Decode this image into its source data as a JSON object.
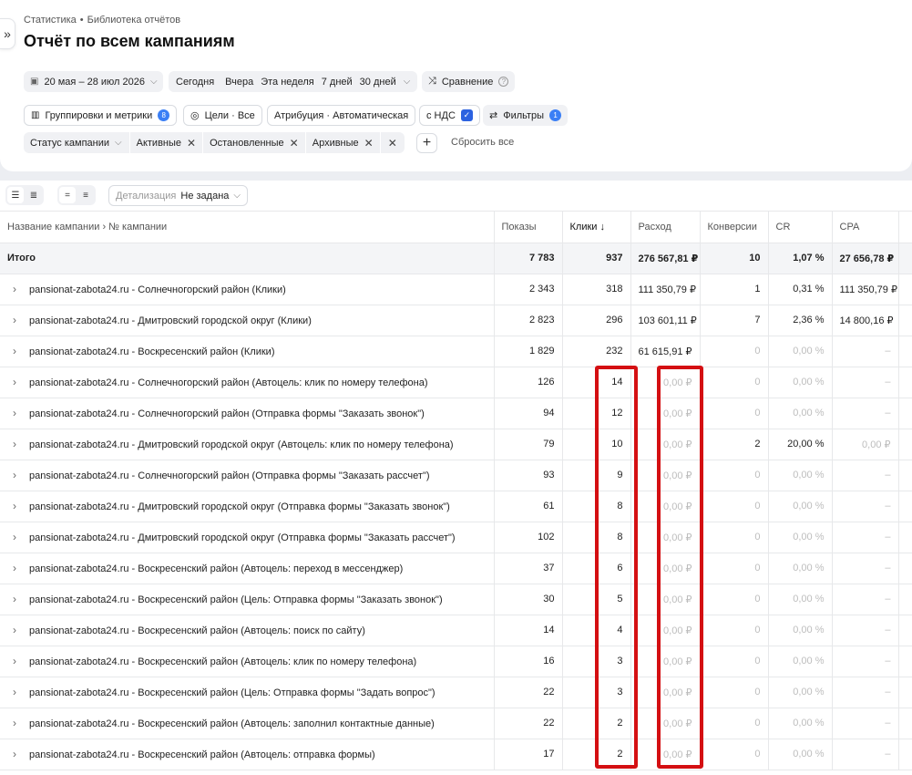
{
  "breadcrumb": [
    "Статистика",
    "•",
    "Библиотека отчётов"
  ],
  "page_title": "Отчёт по всем кампаниям",
  "toolbar": {
    "date_range": "20 мая – 28 июл 2026",
    "presets": [
      "Сегодня",
      "Вчера",
      "Эта неделя",
      "7 дней",
      "30 дней"
    ],
    "compare": "Сравнение",
    "groupings": "Группировки и метрики",
    "groupings_count": "8",
    "goals": "Цели · Все",
    "attribution": "Атрибуция · Автоматическая",
    "vat": "с НДС",
    "filters": "Фильтры",
    "filters_count": "1",
    "status_filter": "Статус кампании",
    "status_values": [
      "Активные",
      "Остановленные",
      "Архивные"
    ],
    "reset": "Сбросить все"
  },
  "detail": {
    "label": "Детализация",
    "value": "Не задана"
  },
  "table": {
    "columns": [
      "Название кампании › № кампании",
      "Показы",
      "Клики ↓",
      "Расход",
      "Конверсии",
      "CR",
      "CPA"
    ],
    "total": [
      "Итого",
      "7 783",
      "937",
      "276 567,81 ₽",
      "10",
      "1,07 %",
      "27 656,78 ₽"
    ],
    "rows": [
      [
        "pansionat-zabota24.ru - Солнечногорский район (Клики)",
        "2 343",
        "318",
        "111 350,79 ₽",
        "1",
        "0,31 %",
        "111 350,79 ₽"
      ],
      [
        "pansionat-zabota24.ru - Дмитровский городской округ (Клики)",
        "2 823",
        "296",
        "103 601,11 ₽",
        "7",
        "2,36 %",
        "14 800,16 ₽"
      ],
      [
        "pansionat-zabota24.ru - Воскресенский район (Клики)",
        "1 829",
        "232",
        "61 615,91 ₽",
        "0",
        "0,00 %",
        "–"
      ],
      [
        "pansionat-zabota24.ru - Солнечногорский район (Автоцель: клик по номеру телефона)",
        "126",
        "14",
        "0,00 ₽",
        "0",
        "0,00 %",
        "–"
      ],
      [
        "pansionat-zabota24.ru - Солнечногорский район (Отправка формы \"Заказать звонок\")",
        "94",
        "12",
        "0,00 ₽",
        "0",
        "0,00 %",
        "–"
      ],
      [
        "pansionat-zabota24.ru - Дмитровский городской округ (Автоцель: клик по номеру телефона)",
        "79",
        "10",
        "0,00 ₽",
        "2",
        "20,00 %",
        "0,00 ₽"
      ],
      [
        "pansionat-zabota24.ru - Солнечногорский район (Отправка формы \"Заказать рассчет\")",
        "93",
        "9",
        "0,00 ₽",
        "0",
        "0,00 %",
        "–"
      ],
      [
        "pansionat-zabota24.ru - Дмитровский городской округ (Отправка формы \"Заказать звонок\")",
        "61",
        "8",
        "0,00 ₽",
        "0",
        "0,00 %",
        "–"
      ],
      [
        "pansionat-zabota24.ru - Дмитровский городской округ (Отправка формы \"Заказать рассчет\")",
        "102",
        "8",
        "0,00 ₽",
        "0",
        "0,00 %",
        "–"
      ],
      [
        "pansionat-zabota24.ru - Воскресенский район (Автоцель: переход в мессенджер)",
        "37",
        "6",
        "0,00 ₽",
        "0",
        "0,00 %",
        "–"
      ],
      [
        "pansionat-zabota24.ru - Воскресенский район (Цель: Отправка формы \"Заказать звонок\")",
        "30",
        "5",
        "0,00 ₽",
        "0",
        "0,00 %",
        "–"
      ],
      [
        "pansionat-zabota24.ru - Воскресенский район (Автоцель: поиск по сайту)",
        "14",
        "4",
        "0,00 ₽",
        "0",
        "0,00 %",
        "–"
      ],
      [
        "pansionat-zabota24.ru - Воскресенский район (Автоцель: клик по номеру телефона)",
        "16",
        "3",
        "0,00 ₽",
        "0",
        "0,00 %",
        "–"
      ],
      [
        "pansionat-zabota24.ru - Воскресенский район (Цель: Отправка формы \"Задать вопрос\")",
        "22",
        "3",
        "0,00 ₽",
        "0",
        "0,00 %",
        "–"
      ],
      [
        "pansionat-zabota24.ru - Воскресенский район (Автоцель: заполнил контактные данные)",
        "22",
        "2",
        "0,00 ₽",
        "0",
        "0,00 %",
        "–"
      ],
      [
        "pansionat-zabota24.ru - Воскресенский район (Автоцель: отправка формы)",
        "17",
        "2",
        "0,00 ₽",
        "0",
        "0,00 %",
        "–"
      ]
    ]
  },
  "colors": {
    "accent": "#3b7ff5",
    "highlight": "#d40f12"
  }
}
